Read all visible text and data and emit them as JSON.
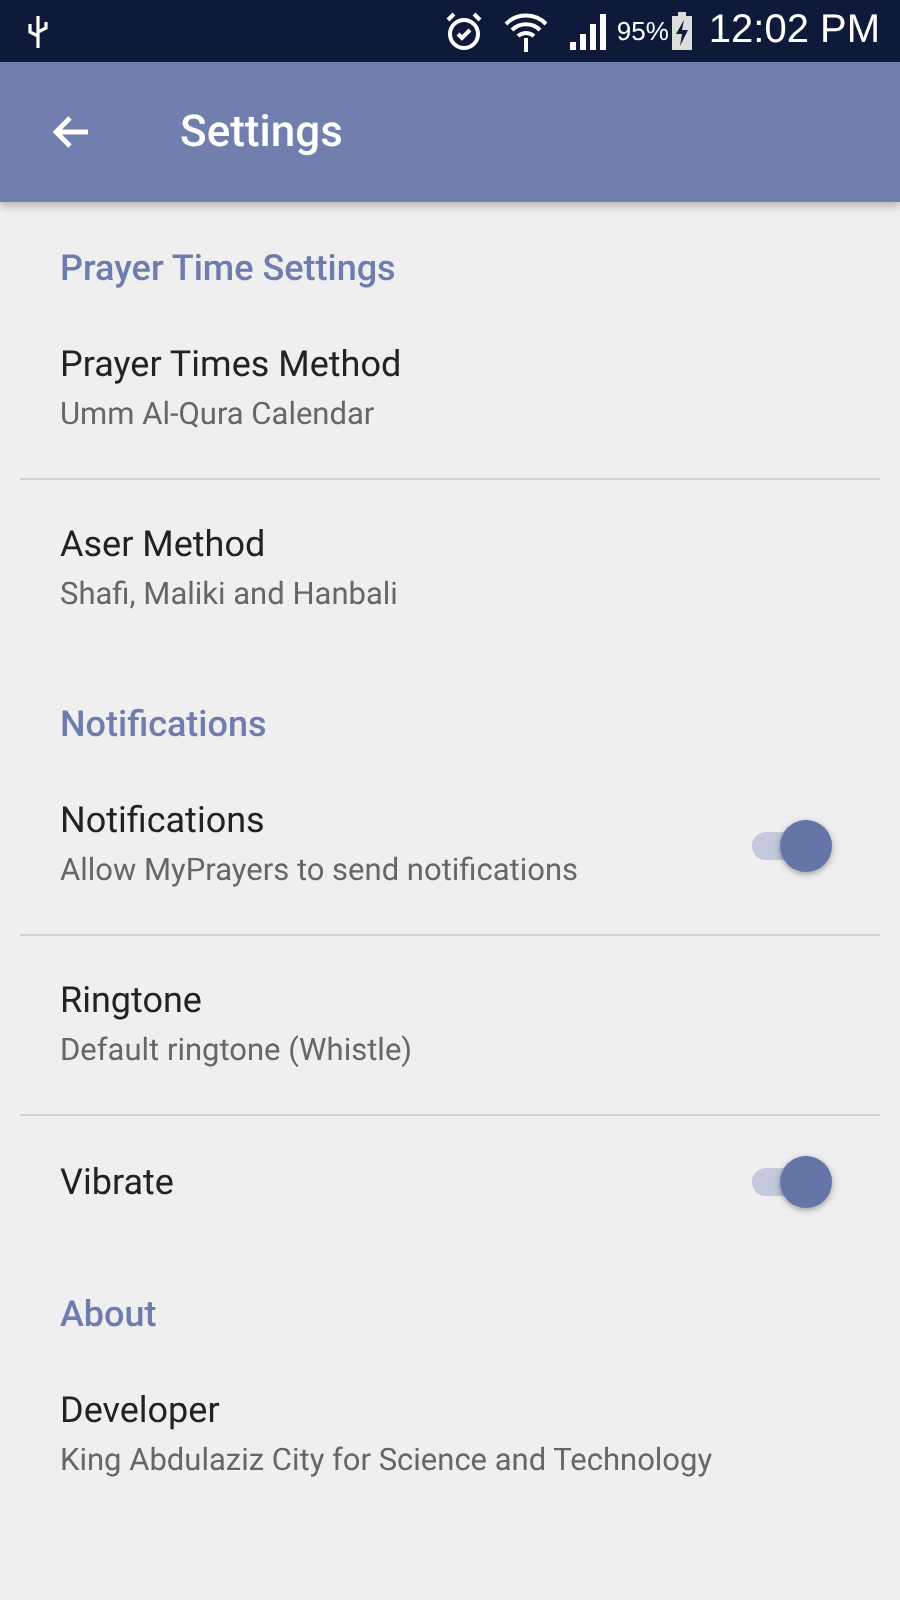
{
  "status_bar": {
    "battery": "95%",
    "time": "12:02 PM"
  },
  "app_bar": {
    "title": "Settings"
  },
  "sections": [
    {
      "header": "Prayer Time Settings",
      "items": [
        {
          "kind": "text",
          "title": "Prayer Times Method",
          "summary": "Umm Al-Qura Calendar"
        },
        {
          "kind": "text",
          "title": "Aser Method",
          "summary": "Shafi, Maliki and Hanbali"
        }
      ]
    },
    {
      "header": "Notifications",
      "items": [
        {
          "kind": "switch",
          "title": "Notifications",
          "summary": "Allow MyPrayers to send notifications",
          "on": true
        },
        {
          "kind": "text",
          "title": "Ringtone",
          "summary": "Default ringtone (Whistle)"
        },
        {
          "kind": "switch",
          "title": "Vibrate",
          "on": true
        }
      ]
    },
    {
      "header": "About",
      "items": [
        {
          "kind": "text",
          "title": "Developer",
          "summary": "King Abdulaziz City for Science and Technology"
        }
      ]
    }
  ]
}
